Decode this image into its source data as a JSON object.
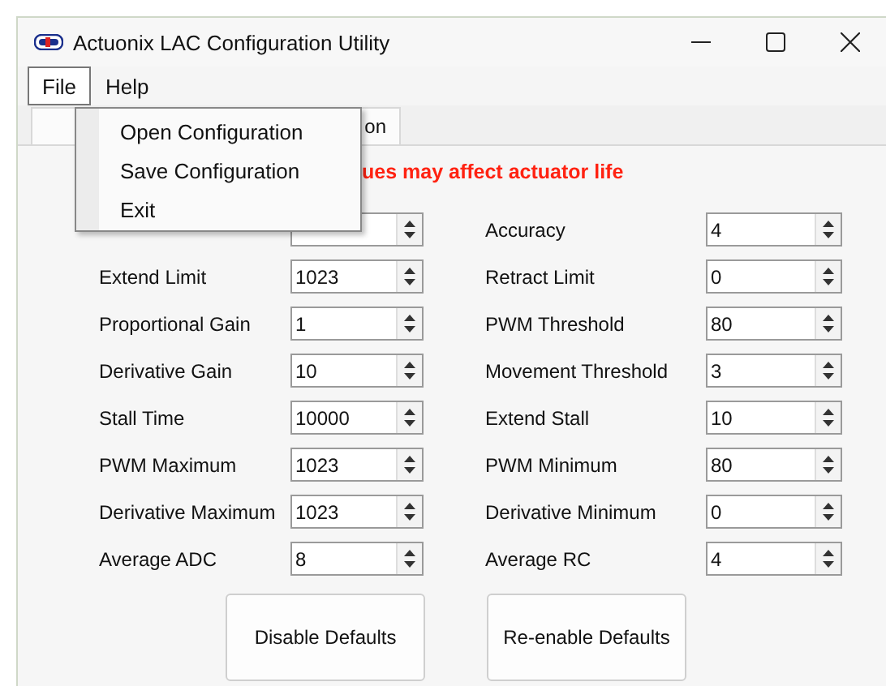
{
  "window": {
    "title": "Actuonix LAC Configuration Utility"
  },
  "menu_bar": [
    {
      "label": "File",
      "selected": true
    },
    {
      "label": "Help",
      "selected": false
    }
  ],
  "open_menu": {
    "items": [
      "Open Configuration",
      "Save Configuration",
      "Exit"
    ]
  },
  "tabs": [
    {
      "label": "on",
      "selected": true
    }
  ],
  "warning": "ues may affect actuator life",
  "params_left": [
    {
      "label": "Extend Limit",
      "value": "1023"
    },
    {
      "label": "Proportional Gain",
      "value": "1"
    },
    {
      "label": "Derivative Gain",
      "value": "10"
    },
    {
      "label": "Stall Time",
      "value": "10000"
    },
    {
      "label": "PWM Maximum",
      "value": "1023"
    },
    {
      "label": "Derivative Maximum",
      "value": "1023"
    },
    {
      "label": "Average ADC",
      "value": "8"
    }
  ],
  "params_right": [
    {
      "label": "Accuracy",
      "value": "4"
    },
    {
      "label": "Retract Limit",
      "value": "0"
    },
    {
      "label": "PWM Threshold",
      "value": "80"
    },
    {
      "label": "Movement Threshold",
      "value": "3"
    },
    {
      "label": "Extend Stall",
      "value": "10"
    },
    {
      "label": "PWM Minimum",
      "value": "80"
    },
    {
      "label": "Derivative Minimum",
      "value": "0"
    },
    {
      "label": "Average RC",
      "value": "4"
    }
  ],
  "buttons": [
    "Disable Defaults",
    "Re-enable Defaults"
  ]
}
